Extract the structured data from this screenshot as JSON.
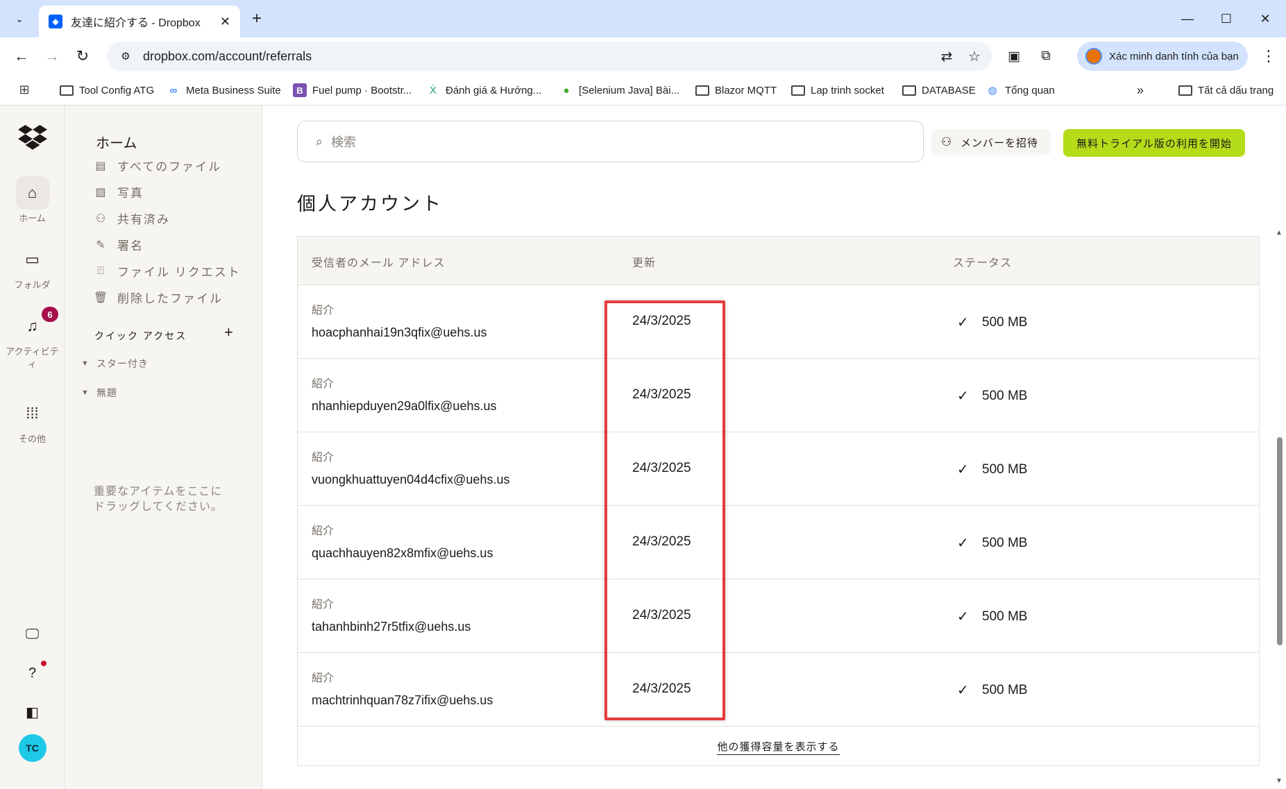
{
  "browser": {
    "tab_title": "友達に紹介する - Dropbox",
    "url": "dropbox.com/account/referrals",
    "profile_label": "Xác minh danh tính của bạn",
    "bookmarks": [
      {
        "label": "Tool Config ATG",
        "icon": "folder-icon"
      },
      {
        "label": "Meta Business Suite",
        "icon": "meta-icon"
      },
      {
        "label": "Fuel pump · Bootstr...",
        "icon": "bootstrap-icon"
      },
      {
        "label": "Đánh giá & Hướng...",
        "icon": "x-icon"
      },
      {
        "label": "[Selenium Java] Bài...",
        "icon": "selenium-icon"
      },
      {
        "label": "Blazor MQTT",
        "icon": "folder-icon"
      },
      {
        "label": "Lap trinh socket",
        "icon": "folder-icon"
      },
      {
        "label": "DATABASE",
        "icon": "folder-icon"
      },
      {
        "label": "Tổng quan",
        "icon": "globe-icon"
      }
    ],
    "all_bookmarks": "Tất cả dấu trang"
  },
  "rail": {
    "home": "ホーム",
    "folders": "フォルダ",
    "activity": "アクティビティ",
    "activity_badge": "6",
    "more": "その他",
    "avatar_initials": "TC"
  },
  "sidebar": {
    "title": "ホーム",
    "items": [
      {
        "label": "すべてのファイル",
        "icon": "files-icon"
      },
      {
        "label": "写真",
        "icon": "photo-icon"
      },
      {
        "label": "共有済み",
        "icon": "shared-icon"
      },
      {
        "label": "署名",
        "icon": "signature-icon"
      },
      {
        "label": "ファイル リクエスト",
        "icon": "file-request-icon"
      },
      {
        "label": "削除したファイル",
        "icon": "trash-icon"
      }
    ],
    "quick_access": "クイック アクセス",
    "starred": "スター付き",
    "untitled": "無題",
    "hint": "重要なアイテムをここにドラッグしてください。"
  },
  "main": {
    "search_placeholder": "検索",
    "invite_label": "メンバーを招待",
    "trial_label": "無料トライアル版の利用を開始",
    "title": "個人アカウント",
    "columns": {
      "email": "受信者のメール アドレス",
      "updated": "更新",
      "status": "ステータス"
    },
    "rows": [
      {
        "kind": "紹介",
        "email": "hoacphanhai19n3qfix@uehs.us",
        "date": "24/3/2025",
        "status": "500 MB"
      },
      {
        "kind": "紹介",
        "email": "nhanhiepduyen29a0lfix@uehs.us",
        "date": "24/3/2025",
        "status": "500 MB"
      },
      {
        "kind": "紹介",
        "email": "vuongkhuattuyen04d4cfix@uehs.us",
        "date": "24/3/2025",
        "status": "500 MB"
      },
      {
        "kind": "紹介",
        "email": "quachhauyen82x8mfix@uehs.us",
        "date": "24/3/2025",
        "status": "500 MB"
      },
      {
        "kind": "紹介",
        "email": "tahanhbinh27r5tfix@uehs.us",
        "date": "24/3/2025",
        "status": "500 MB"
      },
      {
        "kind": "紹介",
        "email": "machtrinhquan78z7ifix@uehs.us",
        "date": "24/3/2025",
        "status": "500 MB"
      }
    ],
    "more_link": "他の獲得容量を表示する"
  },
  "colors": {
    "accent_green": "#b4dc19",
    "dropbox_blue": "#0061fe",
    "highlight_red": "#e63b3b",
    "badge_red": "#a5104a",
    "avatar_cyan": "#1ec9e8"
  }
}
